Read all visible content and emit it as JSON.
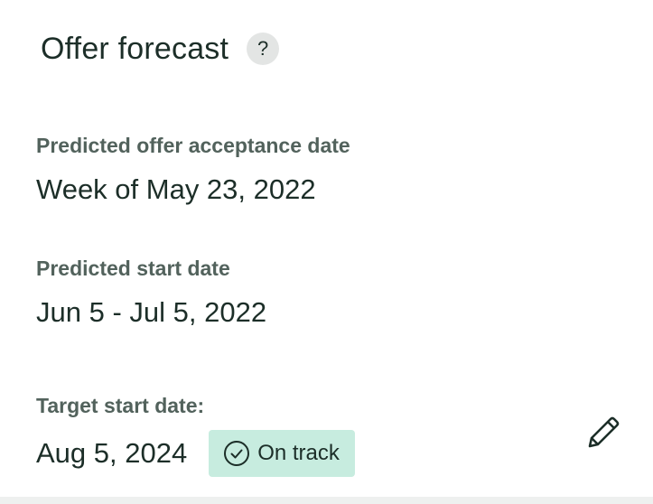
{
  "header": {
    "title": "Offer forecast",
    "help_label": "?",
    "help_icon": "question-mark-icon"
  },
  "predicted_offer_acceptance": {
    "label": "Predicted offer acceptance date",
    "value": "Week of May 23, 2022"
  },
  "predicted_start": {
    "label": "Predicted start date",
    "value": "Jun 5 -  Jul 5, 2022"
  },
  "target_start": {
    "label": "Target start date:",
    "value": "Aug 5, 2024",
    "status": {
      "label": "On track",
      "icon": "check-circle-icon",
      "bg_color": "#c7ecdf"
    },
    "edit_icon": "pencil-icon"
  },
  "colors": {
    "text_primary": "#1c2e28",
    "text_label": "#52625c",
    "help_bg": "#e3e5e4"
  }
}
